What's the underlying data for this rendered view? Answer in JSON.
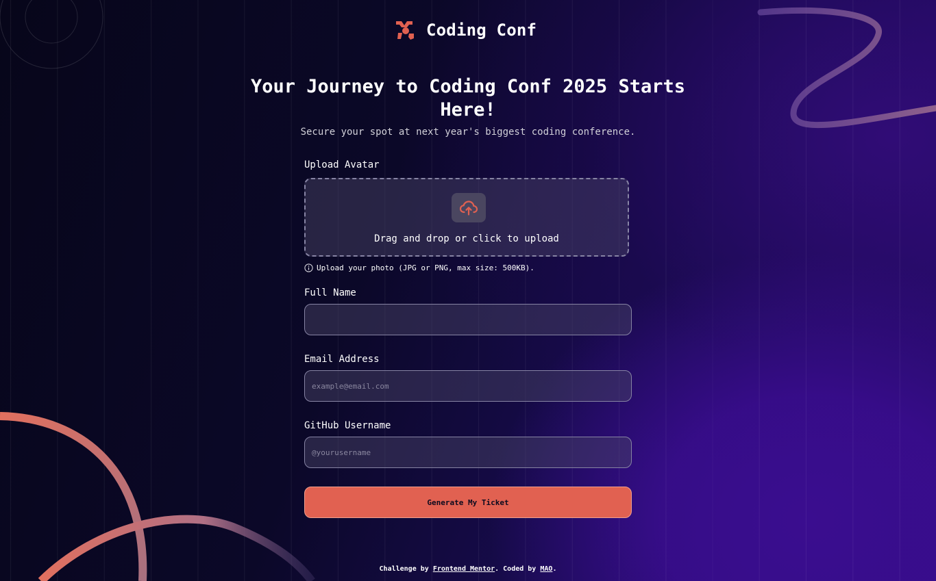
{
  "brand": {
    "name": "Coding Conf",
    "accent": "#e16151"
  },
  "hero": {
    "title": "Your Journey to Coding Conf 2025 Starts Here!",
    "subtitle": "Secure your spot at next year's biggest coding conference."
  },
  "form": {
    "avatar": {
      "label": "Upload Avatar",
      "dropzone_text": "Drag and drop or click to upload",
      "hint": "Upload your photo (JPG or PNG, max size: 500KB).",
      "icon": "cloud-upload-icon"
    },
    "full_name": {
      "label": "Full Name",
      "value": "",
      "placeholder": ""
    },
    "email": {
      "label": "Email Address",
      "value": "",
      "placeholder": "example@email.com"
    },
    "github": {
      "label": "GitHub Username",
      "value": "",
      "placeholder": "@yourusername"
    },
    "submit_label": "Generate My Ticket"
  },
  "footer": {
    "prefix": "Challenge by",
    "challenge_link": "Frontend Mentor",
    "middle": ". Coded by",
    "author_link": "MAO",
    "suffix": "."
  },
  "colors": {
    "background_dark": "#0b0820",
    "background_purple": "#3a0d8f",
    "field_border": "#8784a4",
    "button": "#e16151"
  }
}
